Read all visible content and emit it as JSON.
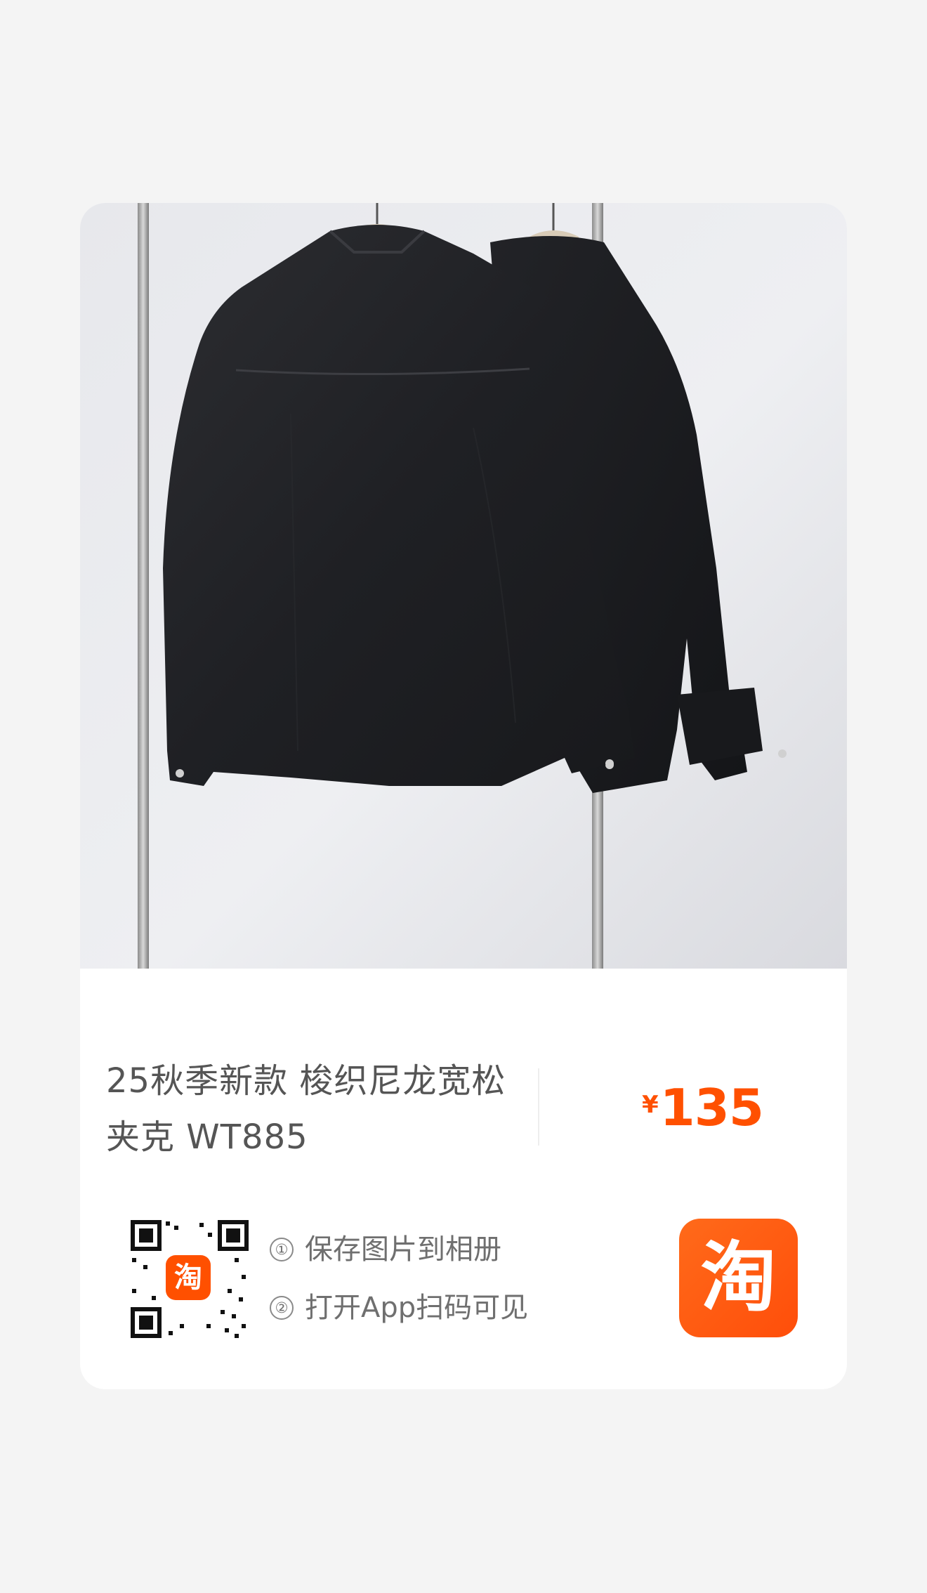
{
  "product": {
    "title_line1": "25秋季新款 梭织尼龙宽松",
    "title_line2": "夹克 WT885",
    "currency": "¥",
    "price": "135"
  },
  "share": {
    "step1_num": "①",
    "step1_text": "保存图片到相册",
    "step2_num": "②",
    "step2_text": "打开App扫码可见",
    "qr_badge": "淘",
    "app_logo": "淘"
  },
  "colors": {
    "price": "#ff5000",
    "logo": "#ff5000",
    "background": "#f4f4f4",
    "card": "#ffffff"
  }
}
